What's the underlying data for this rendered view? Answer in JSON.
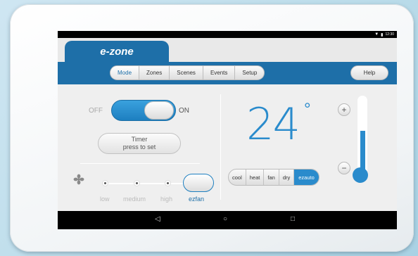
{
  "statusbar": {
    "time": "12:30",
    "icons": [
      "wifi-icon",
      "battery-icon"
    ]
  },
  "app": {
    "logo": "e-zone"
  },
  "nav": {
    "tabs": [
      {
        "label": "Mode",
        "active": true
      },
      {
        "label": "Zones",
        "active": false
      },
      {
        "label": "Scenes",
        "active": false
      },
      {
        "label": "Events",
        "active": false
      },
      {
        "label": "Setup",
        "active": false
      }
    ],
    "help_label": "Help"
  },
  "power": {
    "off_label": "OFF",
    "on_label": "ON",
    "state": "on"
  },
  "timer": {
    "title": "Timer",
    "subtitle": "press to set"
  },
  "fan": {
    "speeds": [
      "low",
      "medium",
      "high",
      "ezfan"
    ],
    "selected": "ezfan"
  },
  "temperature": {
    "value": "24",
    "unit": "°",
    "plus_label": "+",
    "minus_label": "−"
  },
  "modes": {
    "options": [
      "cool",
      "heat",
      "fan",
      "dry",
      "ezauto"
    ],
    "selected": "ezauto"
  },
  "colors": {
    "accent": "#1e6fa8",
    "temp": "#2a8bcc"
  }
}
